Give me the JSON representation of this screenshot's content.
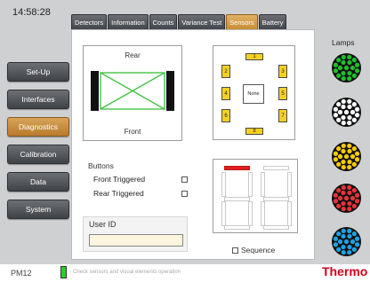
{
  "clock": "14:58:28",
  "sidebar": {
    "items": [
      {
        "label": "Set-Up"
      },
      {
        "label": "Interfaces"
      },
      {
        "label": "Diagnostics",
        "active": true
      },
      {
        "label": "Calibration"
      },
      {
        "label": "Data"
      },
      {
        "label": "System"
      }
    ]
  },
  "tabs": [
    {
      "label": "Detectors"
    },
    {
      "label": "Information"
    },
    {
      "label": "Counts"
    },
    {
      "label": "Variance Test"
    },
    {
      "label": "Sensors",
      "active": true
    },
    {
      "label": "Battery"
    }
  ],
  "sensor_diagram": {
    "rear_label": "Rear",
    "front_label": "Front",
    "line_color": "#43c443"
  },
  "lamp_grid": {
    "numbers": [
      "1",
      "2",
      "3",
      "4",
      "5",
      "6",
      "7",
      "8"
    ],
    "none_label": "None",
    "color": "#f5d020"
  },
  "buttons_group": {
    "title": "Buttons",
    "front_triggered": "Front Triggered",
    "rear_triggered": "Rear Triggered"
  },
  "user_id": {
    "label": "User ID",
    "value": ""
  },
  "sequence_label": "Sequence",
  "lamps": {
    "title": "Lamps",
    "colors": [
      "#1fbf2a",
      "#ffffff",
      "#ffcc00",
      "#e8333a",
      "#1fa3e6"
    ]
  },
  "status_bar": {
    "model": "PM12",
    "message": "Check sensors and visual elements operation",
    "brand": "Thermo"
  }
}
